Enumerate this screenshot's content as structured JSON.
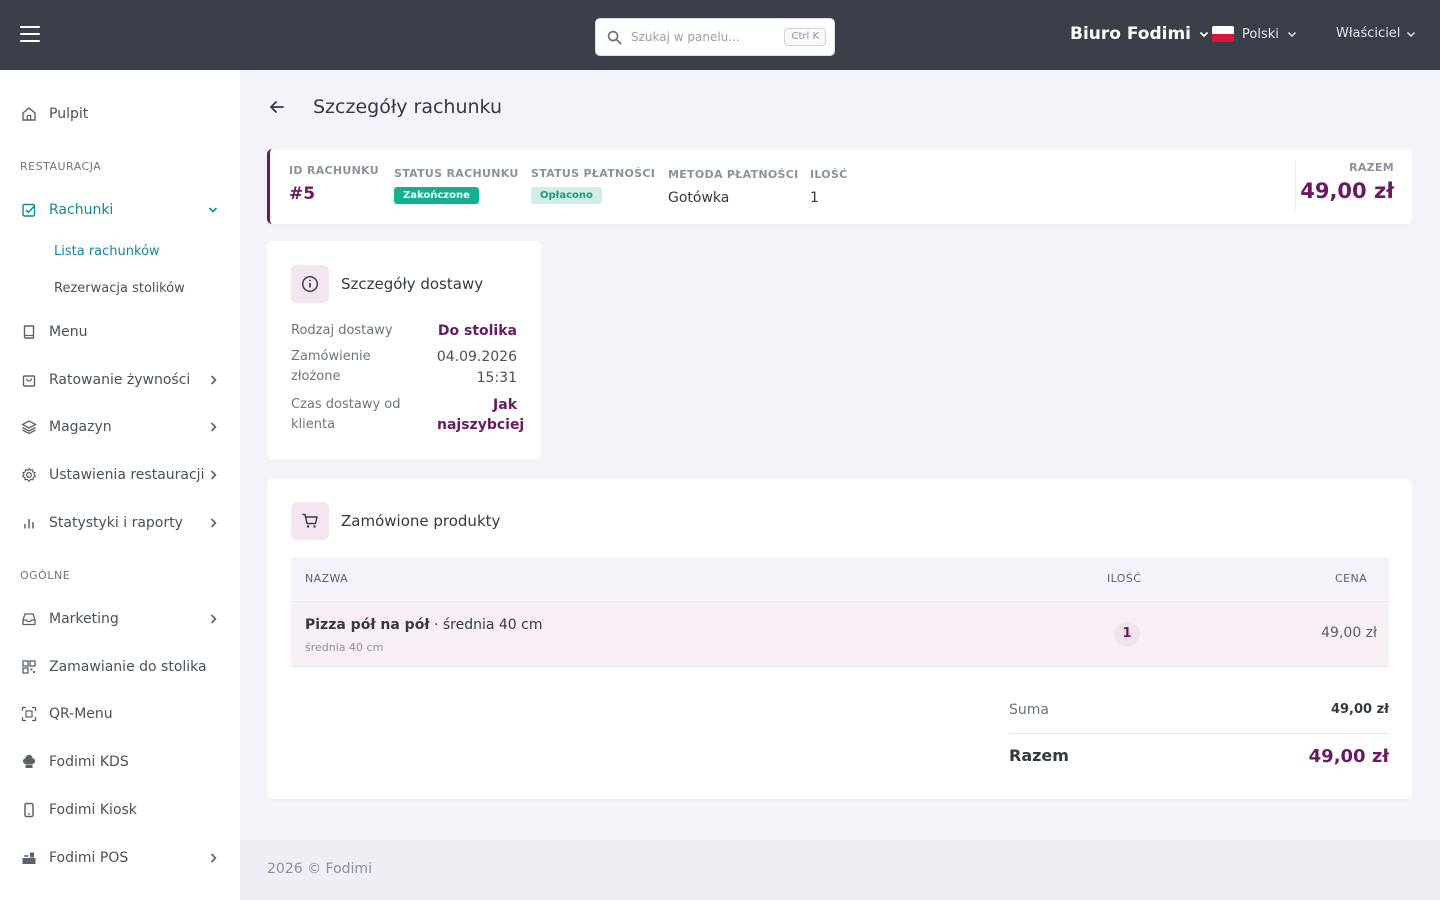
{
  "topbar": {
    "search_placeholder": "Szukaj w panelu...",
    "search_shortcut": "Ctrl K",
    "org_name": "Biuro Fodimi",
    "language": "Polski",
    "user_role": "Właściciel"
  },
  "sidebar": {
    "dashboard": "Pulpit",
    "section_restaurant": "RESTAURACJA",
    "bills": "Rachunki",
    "bills_list": "Lista rachunków",
    "table_reservation": "Rezerwacja stolików",
    "menu": "Menu",
    "food_rescue": "Ratowanie żywności",
    "warehouse": "Magazyn",
    "restaurant_settings": "Ustawienia restauracji",
    "stats_reports": "Statystyki i raporty",
    "section_general": "OGÓLNE",
    "marketing": "Marketing",
    "table_ordering": "Zamawianie do stolika",
    "qr_menu": "QR-Menu",
    "kds": "Fodimi KDS",
    "kiosk": "Fodimi Kiosk",
    "pos": "Fodimi POS"
  },
  "page": {
    "title": "Szczegóły rachunku"
  },
  "summary": {
    "id_label": "ID RACHUNKU",
    "id_value": "#5",
    "status_label": "STATUS RACHUNKU",
    "status_value": "Zakończone",
    "payment_status_label": "STATUS PŁATNOŚCI",
    "payment_status_value": "Opłacono",
    "payment_method_label": "METODA PŁATNOŚCI",
    "payment_method_value": "Gotówka",
    "qty_label": "ILOŚĆ",
    "qty_value": "1",
    "total_label": "RAZEM",
    "total_value": "49,00 zł"
  },
  "delivery": {
    "title": "Szczegóły dostawy",
    "type_label": "Rodzaj dostawy",
    "type_value": "Do stolika",
    "placed_label": "Zamówienie złożone",
    "placed_date": "04.09.2026",
    "placed_time": "15:31",
    "time_label": "Czas dostawy od klienta",
    "time_value": "Jak najszybciej"
  },
  "products": {
    "title": "Zamówione produkty",
    "col_name": "NAZWA",
    "col_qty": "ILOŚĆ",
    "col_price": "CENA",
    "rows": [
      {
        "name": "Pizza pół na pół",
        "variant": " · średnia 40 cm",
        "sub": "średnia 40 cm",
        "qty": "1",
        "price": "49,00 zł"
      }
    ],
    "sum_label": "Suma",
    "sum_value": "49,00 zł",
    "total_label": "Razem",
    "total_value": "49,00 zł"
  },
  "footer": {
    "text": "2026 © Fodimi"
  },
  "colors": {
    "brand": "#6a1a63",
    "accent_teal": "#0e8a9c",
    "status_green": "#13b092"
  }
}
